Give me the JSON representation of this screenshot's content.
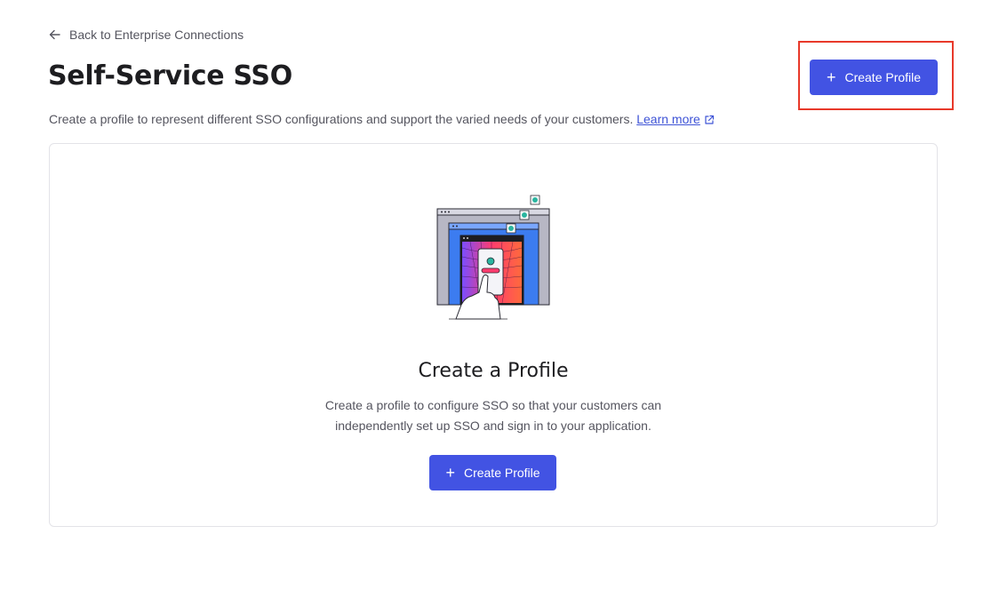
{
  "back_link": {
    "label": "Back to Enterprise Connections",
    "icon": "arrow-left-icon"
  },
  "header": {
    "title": "Self-Service SSO",
    "subtitle": "Create a profile to represent different SSO configurations and support the varied needs of your customers.",
    "learn_more": "Learn more",
    "create_button": "Create Profile"
  },
  "empty_state": {
    "title": "Create a Profile",
    "description_line1": "Create a profile to configure SSO so that your customers can",
    "description_line2": "independently set up SSO and sign in to your application.",
    "button": "Create Profile"
  },
  "colors": {
    "primary": "#4253e3",
    "link": "#3e53d6",
    "highlight": "#e8392a"
  }
}
